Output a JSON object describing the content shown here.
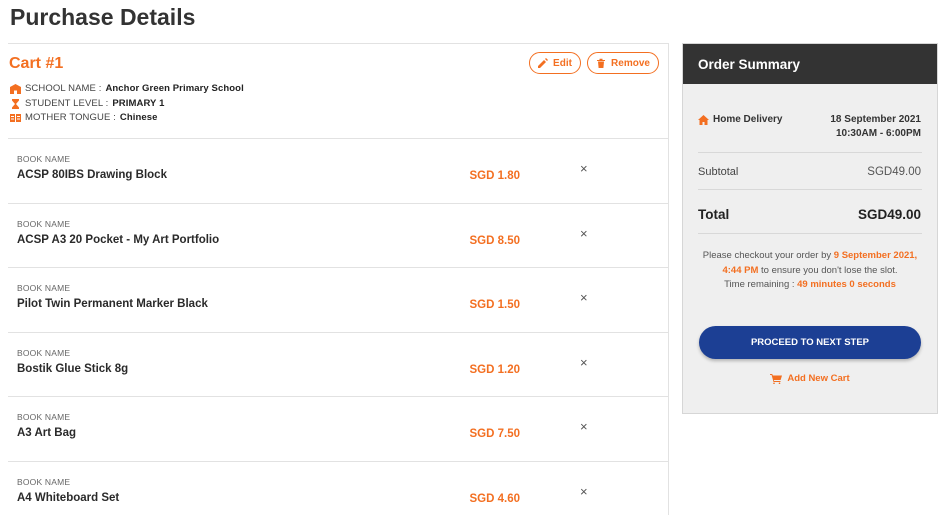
{
  "page": {
    "title": "Purchase Details"
  },
  "cart": {
    "title": "Cart #1",
    "edit_label": "Edit",
    "remove_label": "Remove",
    "info": [
      {
        "label": "SCHOOL NAME : ",
        "value": "Anchor Green Primary School"
      },
      {
        "label": "STUDENT LEVEL : ",
        "value": "PRIMARY 1"
      },
      {
        "label": "MOTHER TONGUE : ",
        "value": "Chinese"
      }
    ],
    "book_label": "BOOK NAME",
    "remove_glyph": "×",
    "books": [
      {
        "name": "ACSP 80IBS Drawing Block",
        "price": "SGD 1.80"
      },
      {
        "name": "ACSP A3 20 Pocket - My Art Portfolio",
        "price": "SGD 8.50"
      },
      {
        "name": "Pilot Twin Permanent Marker Black",
        "price": "SGD 1.50"
      },
      {
        "name": "Bostik Glue Stick 8g",
        "price": "SGD 1.20"
      },
      {
        "name": "A3 Art Bag",
        "price": "SGD 7.50"
      },
      {
        "name": "A4 Whiteboard Set",
        "price": "SGD 4.60"
      }
    ]
  },
  "summary": {
    "title": "Order Summary",
    "delivery_label": "Home Delivery",
    "delivery_date": "18 September 2021",
    "delivery_time": "10:30AM - 6:00PM",
    "subtotal_label": "Subtotal",
    "subtotal_value": "SGD49.00",
    "total_label": "Total",
    "total_value": "SGD49.00",
    "note_prefix": "Please checkout your order by ",
    "note_deadline": "9 September 2021, 4:44 PM",
    "note_suffix": " to ensure you don't lose the slot.",
    "remaining_label": "Time remaining : ",
    "remaining_value": "49 minutes 0 seconds",
    "proceed_label": "PROCEED TO NEXT STEP",
    "add_cart_label": "Add New Cart"
  },
  "icons": {
    "school": "school-icon",
    "level": "hourglass-icon",
    "tongue": "language-icon",
    "edit": "pencil-icon",
    "remove": "trash-icon",
    "delivery": "home-icon",
    "add_cart": "cart-icon"
  },
  "colors": {
    "accent": "#f36f21",
    "primary_button": "#1c3f94",
    "summary_header": "#333333"
  }
}
